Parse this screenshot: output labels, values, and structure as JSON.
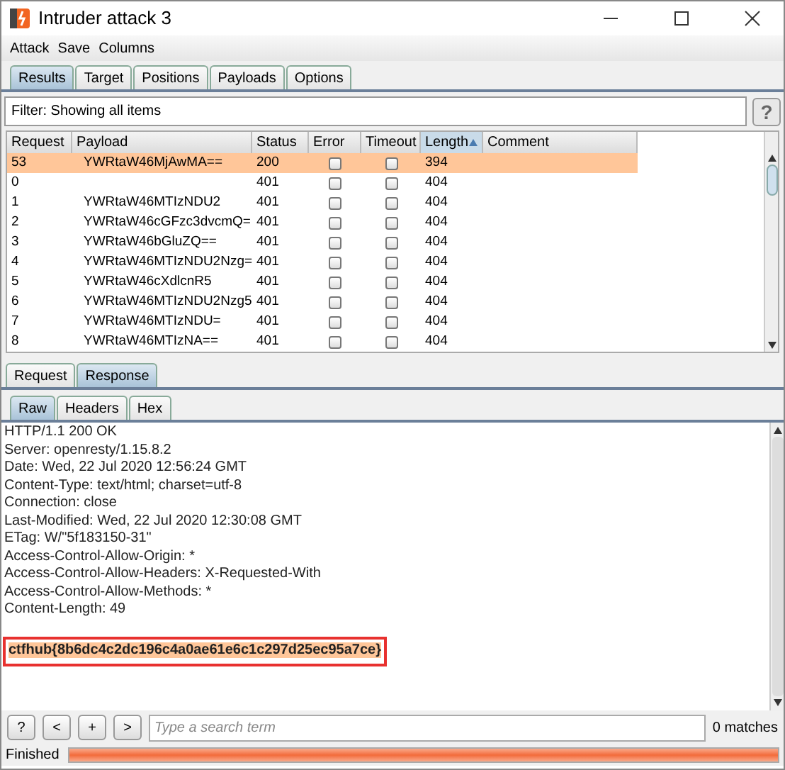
{
  "window": {
    "title": "Intruder attack 3"
  },
  "menu": [
    "Attack",
    "Save",
    "Columns"
  ],
  "tabs": [
    {
      "label": "Results",
      "selected": true
    },
    {
      "label": "Target",
      "selected": false
    },
    {
      "label": "Positions",
      "selected": false
    },
    {
      "label": "Payloads",
      "selected": false
    },
    {
      "label": "Options",
      "selected": false
    }
  ],
  "filter": {
    "text": "Filter: Showing all items",
    "help": "?"
  },
  "table": {
    "columns": [
      {
        "label": "Request",
        "sorted": false
      },
      {
        "label": "Payload",
        "sorted": false
      },
      {
        "label": "Status",
        "sorted": false
      },
      {
        "label": "Error",
        "sorted": false
      },
      {
        "label": "Timeout",
        "sorted": false
      },
      {
        "label": "Length",
        "sorted": true
      },
      {
        "label": "Comment",
        "sorted": false
      }
    ],
    "rows": [
      {
        "request": "53",
        "payload": "YWRtaW46MjAwMA==",
        "status": "200",
        "error": false,
        "timeout": false,
        "length": "394",
        "selected": true
      },
      {
        "request": "0",
        "status": "401",
        "error": false,
        "timeout": false,
        "length": "404",
        "selected": false
      },
      {
        "request": "1",
        "payload": "YWRtaW46MTIzNDU2",
        "status": "401",
        "error": false,
        "timeout": false,
        "length": "404",
        "selected": false
      },
      {
        "request": "2",
        "payload": "YWRtaW46cGFzc3dvcmQ=",
        "status": "401",
        "error": false,
        "timeout": false,
        "length": "404",
        "selected": false
      },
      {
        "request": "3",
        "payload": "YWRtaW46bGluZQ==",
        "status": "401",
        "error": false,
        "timeout": false,
        "length": "404",
        "selected": false
      },
      {
        "request": "4",
        "payload": "YWRtaW46MTIzNDU2Nzg=",
        "status": "401",
        "error": false,
        "timeout": false,
        "length": "404",
        "selected": false
      },
      {
        "request": "5",
        "payload": "YWRtaW46cXdlcnR5",
        "status": "401",
        "error": false,
        "timeout": false,
        "length": "404",
        "selected": false
      },
      {
        "request": "6",
        "payload": "YWRtaW46MTIzNDU2Nzg5",
        "status": "401",
        "error": false,
        "timeout": false,
        "length": "404",
        "selected": false
      },
      {
        "request": "7",
        "payload": "YWRtaW46MTIzNDU=",
        "status": "401",
        "error": false,
        "timeout": false,
        "length": "404",
        "selected": false
      },
      {
        "request": "8",
        "payload": "YWRtaW46MTIzNA==",
        "status": "401",
        "error": false,
        "timeout": false,
        "length": "404",
        "selected": false
      }
    ]
  },
  "message_tabs": [
    {
      "label": "Request",
      "selected": false
    },
    {
      "label": "Response",
      "selected": true
    }
  ],
  "view_tabs": [
    {
      "label": "Raw",
      "selected": true
    },
    {
      "label": "Headers",
      "selected": false
    },
    {
      "label": "Hex",
      "selected": false
    }
  ],
  "response": {
    "headers": [
      "HTTP/1.1 200 OK",
      "Server: openresty/1.15.8.2",
      "Date: Wed, 22 Jul 2020 12:56:24 GMT",
      "Content-Type: text/html; charset=utf-8",
      "Connection: close",
      "Last-Modified: Wed, 22 Jul 2020 12:30:08 GMT",
      "ETag: W/\"5f183150-31\"",
      "Access-Control-Allow-Origin: *",
      "Access-Control-Allow-Headers: X-Requested-With",
      "Access-Control-Allow-Methods: *",
      "Content-Length: 49"
    ],
    "body": "ctfhub{8b6dc4c2dc196c4a0ae61e6c1c297d25ec95a7ce}"
  },
  "search": {
    "buttons": [
      "?",
      "<",
      "+",
      ">"
    ],
    "placeholder": "Type a search term",
    "matches": "0 matches"
  },
  "status_bar": {
    "text": "Finished",
    "level": 1
  }
}
